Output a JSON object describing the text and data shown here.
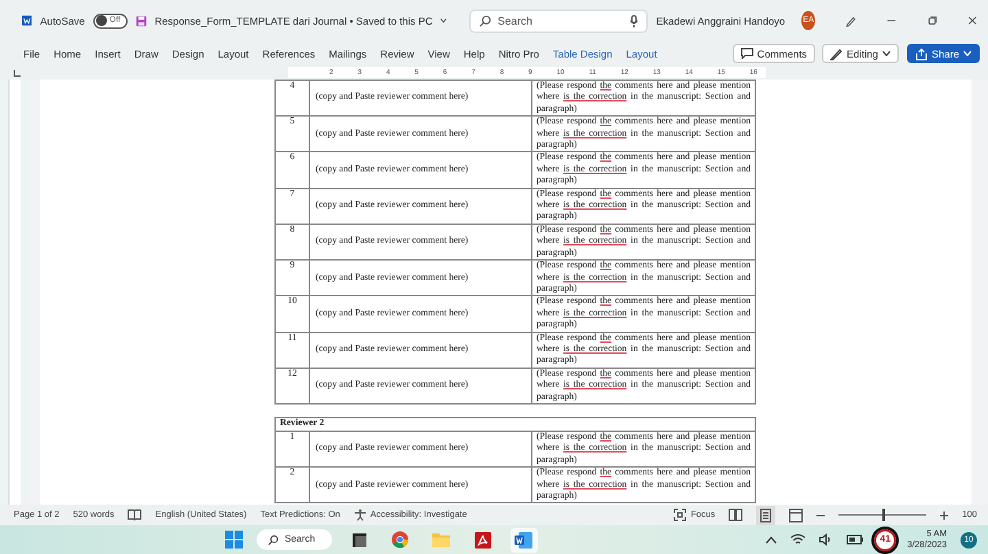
{
  "title_bar": {
    "autosave_label": "AutoSave",
    "autosave": {
      "on": false,
      "label": "Off"
    },
    "document_title": "Response_Form_TEMPLATE dari Journal • Saved to this PC",
    "search": {
      "placeholder": "Search"
    },
    "user_name": "Ekadewi Anggraini Handoyo",
    "avatar_initials": "EA"
  },
  "ribbon": {
    "tabs": [
      {
        "label": "File",
        "kind": "standard"
      },
      {
        "label": "Home",
        "kind": "standard"
      },
      {
        "label": "Insert",
        "kind": "standard"
      },
      {
        "label": "Draw",
        "kind": "standard"
      },
      {
        "label": "Design",
        "kind": "standard"
      },
      {
        "label": "Layout",
        "kind": "standard"
      },
      {
        "label": "References",
        "kind": "standard"
      },
      {
        "label": "Mailings",
        "kind": "standard"
      },
      {
        "label": "Review",
        "kind": "standard"
      },
      {
        "label": "View",
        "kind": "standard"
      },
      {
        "label": "Help",
        "kind": "standard"
      },
      {
        "label": "Nitro Pro",
        "kind": "standard"
      },
      {
        "label": "Table Design",
        "kind": "contextual"
      },
      {
        "label": "Layout",
        "kind": "contextual"
      }
    ],
    "comments": "Comments",
    "editing": "Editing",
    "share": "Share"
  },
  "ruler": {
    "marks": [
      "2",
      "3",
      "4",
      "5",
      "6",
      "7",
      "8",
      "9",
      "10",
      "11",
      "12",
      "13",
      "14",
      "15",
      "16"
    ]
  },
  "document": {
    "sections": [
      {
        "rows": [
          {
            "number": "4",
            "comment": "(copy and Paste reviewer comment here)",
            "response": [
              {
                "text": "(Please respond ",
                "flagged": false
              },
              {
                "text": "the",
                "flagged": true
              },
              {
                "text": " comments here and please mention where ",
                "flagged": false
              },
              {
                "text": "is the correction",
                "flagged": true
              },
              {
                "text": " in the manuscript: Section and paragraph)",
                "flagged": false
              }
            ]
          },
          {
            "number": "5",
            "comment": "(copy and Paste reviewer comment here)",
            "response": [
              {
                "text": "(Please respond ",
                "flagged": false
              },
              {
                "text": "the",
                "flagged": true
              },
              {
                "text": " comments here and please mention where ",
                "flagged": false
              },
              {
                "text": "is the correction",
                "flagged": true
              },
              {
                "text": " in the manuscript: Section and paragraph)",
                "flagged": false
              }
            ]
          },
          {
            "number": "6",
            "comment": "(copy and Paste reviewer comment here)",
            "response": [
              {
                "text": "(Please respond ",
                "flagged": false
              },
              {
                "text": "the",
                "flagged": true
              },
              {
                "text": " comments here and please mention where ",
                "flagged": false
              },
              {
                "text": "is the correction",
                "flagged": true
              },
              {
                "text": " in the manuscript: Section and paragraph)",
                "flagged": false
              }
            ]
          },
          {
            "number": "7",
            "comment": "(copy and Paste reviewer comment here)",
            "response": [
              {
                "text": "(Please respond ",
                "flagged": false
              },
              {
                "text": "the",
                "flagged": true
              },
              {
                "text": " comments here and please mention where ",
                "flagged": false
              },
              {
                "text": "is the correction",
                "flagged": true
              },
              {
                "text": " in the manuscript: Section and paragraph)",
                "flagged": false
              }
            ]
          },
          {
            "number": "8",
            "comment": "(copy and Paste reviewer comment here)",
            "response": [
              {
                "text": "(Please respond ",
                "flagged": false
              },
              {
                "text": "the",
                "flagged": true
              },
              {
                "text": " comments here and please mention where ",
                "flagged": false
              },
              {
                "text": "is the correction",
                "flagged": true
              },
              {
                "text": " in the manuscript: Section and paragraph)",
                "flagged": false
              }
            ]
          },
          {
            "number": "9",
            "comment": "(copy and Paste reviewer comment here)",
            "response": [
              {
                "text": "(Please respond ",
                "flagged": false
              },
              {
                "text": "the",
                "flagged": true
              },
              {
                "text": " comments here and please mention where ",
                "flagged": false
              },
              {
                "text": "is the correction",
                "flagged": true
              },
              {
                "text": " in the manuscript: Section and paragraph)",
                "flagged": false
              }
            ]
          },
          {
            "number": "10",
            "comment": "(copy and Paste reviewer comment here)",
            "response": [
              {
                "text": "(Please respond ",
                "flagged": false
              },
              {
                "text": "the",
                "flagged": true
              },
              {
                "text": " comments here and please mention where ",
                "flagged": false
              },
              {
                "text": "is the correction",
                "flagged": true
              },
              {
                "text": " in the manuscript: Section and paragraph)",
                "flagged": false
              }
            ]
          },
          {
            "number": "11",
            "comment": "(copy and Paste reviewer comment here)",
            "response": [
              {
                "text": "(Please respond ",
                "flagged": false
              },
              {
                "text": "the",
                "flagged": true
              },
              {
                "text": " comments here and please mention where ",
                "flagged": false
              },
              {
                "text": "is the correction",
                "flagged": true
              },
              {
                "text": " in the manuscript: Section and paragraph)",
                "flagged": false
              }
            ]
          },
          {
            "number": "12",
            "comment": "(copy and Paste reviewer comment here)",
            "response": [
              {
                "text": "(Please respond ",
                "flagged": false
              },
              {
                "text": "the",
                "flagged": true
              },
              {
                "text": " comments here and please mention where ",
                "flagged": false
              },
              {
                "text": "is the correction",
                "flagged": true
              },
              {
                "text": " in the manuscript: Section and paragraph)",
                "flagged": false
              }
            ]
          }
        ]
      },
      {
        "header": "Reviewer 2",
        "rows": [
          {
            "number": "1",
            "comment": "(copy and Paste reviewer comment here)",
            "response": [
              {
                "text": "(Please respond ",
                "flagged": false
              },
              {
                "text": "the",
                "flagged": true
              },
              {
                "text": " comments here and please mention where ",
                "flagged": false
              },
              {
                "text": "is the correction",
                "flagged": true
              },
              {
                "text": " in the manuscript: Section and paragraph)",
                "flagged": false
              }
            ]
          },
          {
            "number": "2",
            "comment": "(copy and Paste reviewer comment here)",
            "response": [
              {
                "text": "(Please respond ",
                "flagged": false
              },
              {
                "text": "the",
                "flagged": true
              },
              {
                "text": " comments here and please mention where ",
                "flagged": false
              },
              {
                "text": "is the correction",
                "flagged": true
              },
              {
                "text": " in the manuscript: Section and paragraph)",
                "flagged": false
              }
            ]
          }
        ]
      }
    ]
  },
  "status_bar": {
    "page": "Page 1 of 2",
    "words": "520 words",
    "language": "English (United States)",
    "text_predictions": "Text Predictions: On",
    "accessibility": "Accessibility: Investigate",
    "focus": "Focus",
    "zoom": {
      "level": 0.5,
      "reading": "100"
    }
  },
  "taskbar": {
    "search": "Search",
    "apps": [
      {
        "kind": "taskview",
        "selected": false
      },
      {
        "kind": "chrome",
        "selected": false
      },
      {
        "kind": "folder",
        "selected": false
      },
      {
        "kind": "pdf",
        "selected": false
      },
      {
        "kind": "word",
        "selected": true
      }
    ],
    "overlay_badge": "41",
    "time": "5 AM",
    "date": "3/28/2023",
    "notifications": "10"
  }
}
